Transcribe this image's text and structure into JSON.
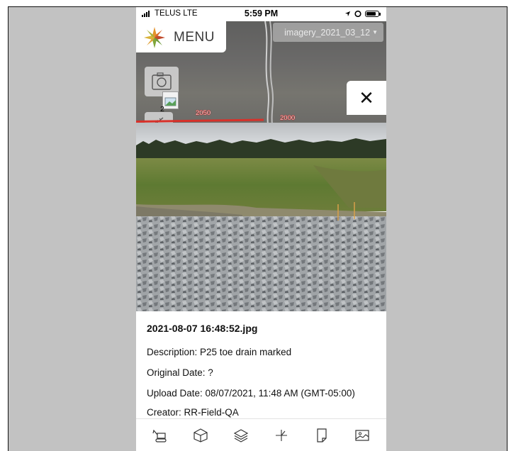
{
  "status_bar": {
    "carrier": "TELUS",
    "network": "LTE",
    "time": "5:59 PM"
  },
  "map": {
    "menu_label": "MENU",
    "imagery_selector": "imagery_2021_03_12",
    "photo_count": "2",
    "chainage_labels": [
      "2050",
      "2000"
    ]
  },
  "photo_info": {
    "filename": "2021-08-07 16:48:52.jpg",
    "description": "Description: P25 toe drain marked",
    "original_date": "Original Date: ?",
    "upload_date": "Upload Date: 08/07/2021, 11:48 AM (GMT-05:00)",
    "creator": "Creator: RR-Field-QA"
  },
  "toolbar": {
    "icons": [
      "excavator-icon",
      "cube-icon",
      "layers-icon",
      "cursor-crosshair-icon",
      "document-icon",
      "image-icon"
    ]
  }
}
